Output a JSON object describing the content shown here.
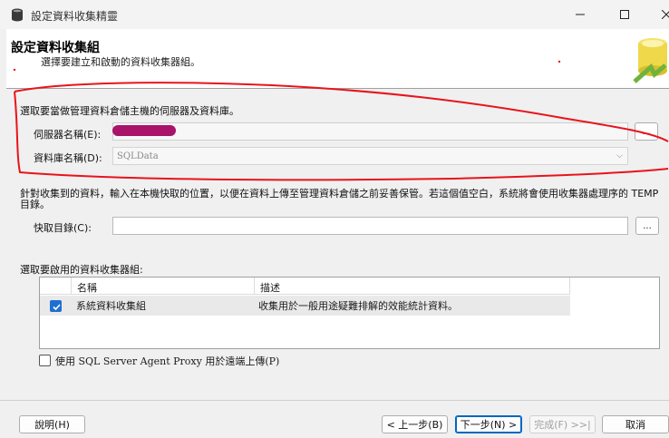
{
  "window": {
    "title": "設定資料收集精靈"
  },
  "banner": {
    "heading": "設定資料收集組",
    "subtitle": "選擇要建立和啟動的資料收集器組。"
  },
  "storage_section": {
    "prompt": "選取要當做管理資料倉儲主機的伺服器及資料庫。",
    "server_label": "伺服器名稱(E):",
    "server_browse": "...",
    "database_label": "資料庫名稱(D):",
    "database_value": "SQLData"
  },
  "cache_section": {
    "description": "針對收集到的資料，輸入在本機快取的位置，以便在資料上傳至管理資料倉儲之前妥善保管。若這個值空白，系統將會使用收集器處理序的 TEMP 目錄。",
    "cache_label": "快取目錄(C):",
    "cache_value": "",
    "cache_browse": "..."
  },
  "collector_section": {
    "prompt": "選取要啟用的資料收集器組:",
    "columns": [
      "名稱",
      "描述"
    ],
    "rows": [
      {
        "checked": true,
        "name": "系統資料收集組",
        "description": "收集用於一般用途疑難排解的效能統計資料。"
      }
    ]
  },
  "proxy": {
    "checked": false,
    "label": "使用 SQL Server Agent Proxy 用於遠端上傳(P)"
  },
  "footer": {
    "help": "說明(H)",
    "back": "< 上一步(B)",
    "next": "下一步(N) >",
    "finish": "完成(F) >>|",
    "cancel": "取消"
  },
  "colors": {
    "accent": "#0067c0",
    "annotation": "#e8141b",
    "redaction": "#a9136a"
  }
}
